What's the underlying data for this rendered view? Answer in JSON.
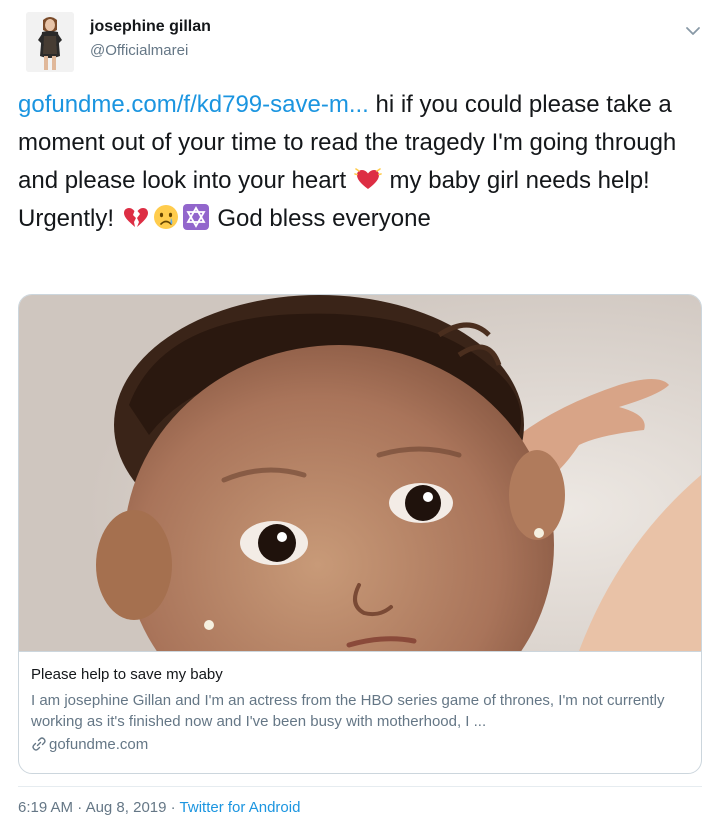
{
  "user": {
    "name": "josephine gillan",
    "handle": "@Officialmarei"
  },
  "tweet": {
    "link_text": "gofundme.com/f/kd799-save-m...",
    "text_1": " hi if you could please take a moment out of your time to read the tragedy I'm going through and please look into your heart ",
    "text_2": " my baby girl needs help! Urgently! ",
    "text_3": " God bless everyone",
    "emojis": [
      "growing-heart-emoji",
      "broken-heart-emoji",
      "crying-face-emoji",
      "star-of-david-emoji"
    ]
  },
  "card": {
    "title": "Please help to save my baby",
    "description": "I am josephine Gillan and I'm an actress from the HBO series game of thrones, I'm not currently working as it's finished now and I've been busy with motherhood, I ...",
    "domain": "gofundme.com"
  },
  "footer": {
    "time": "6:19 AM",
    "separator_1": " · ",
    "date": "Aug 8, 2019",
    "separator_2": " · ",
    "source": "Twitter for Android"
  },
  "colors": {
    "link": "#1b95e0",
    "secondary": "#657786",
    "border": "#ccd6dd"
  }
}
